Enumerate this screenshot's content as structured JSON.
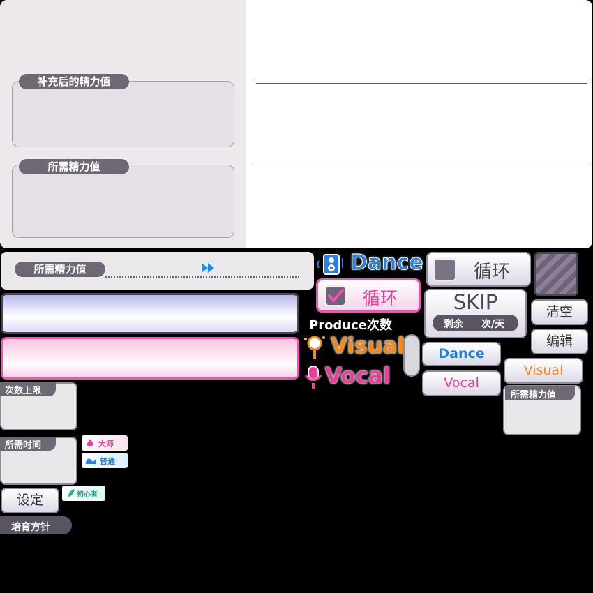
{
  "panel": {
    "replenished_label": "补充后的精力值",
    "required_label": "所需精力值"
  },
  "bar": {
    "required_label": "所需精力值"
  },
  "types": {
    "dance": "Dance",
    "visual": "Visual",
    "vocal": "Vocal"
  },
  "loop": {
    "label_checked": "循环",
    "label_unchecked": "循环"
  },
  "produce_count_label": "Produce次数",
  "skip": {
    "title": "SKIP",
    "remaining": "剩余",
    "per_day": "次/天"
  },
  "buttons": {
    "clear": "清空",
    "edit": "编辑",
    "dance": "Dance",
    "vocal": "Vocal",
    "visual": "Visual",
    "settings": "设定"
  },
  "right_box_label": "所需精力值",
  "left": {
    "count_limit": "次数上限",
    "required_time": "所需时间",
    "policy": "培育方针"
  },
  "difficulty": {
    "master": "大师",
    "normal": "普通",
    "beginner": "初心者"
  },
  "colors": {
    "dance": "#2a7fe0",
    "visual": "#f08a1c",
    "vocal": "#e8409a",
    "tag_bg": "#6e6874"
  }
}
